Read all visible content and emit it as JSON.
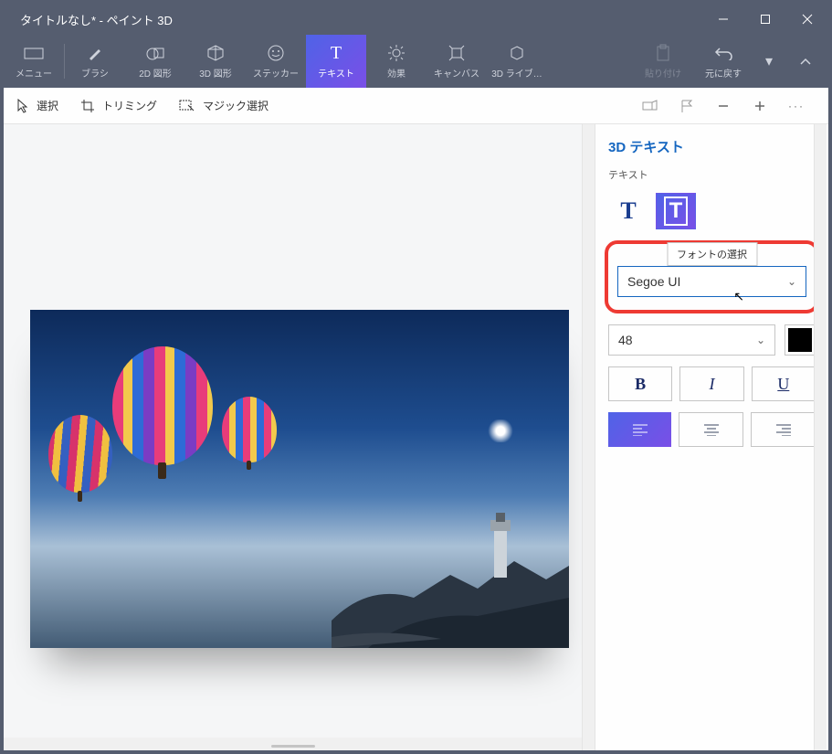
{
  "window": {
    "title": "タイトルなし* - ペイント 3D"
  },
  "ribbon": {
    "items": [
      {
        "label": "メニュー",
        "icon": "folder"
      },
      {
        "label": "ブラシ",
        "icon": "brush"
      },
      {
        "label": "2D 図形",
        "icon": "shape2d"
      },
      {
        "label": "3D 図形",
        "icon": "shape3d"
      },
      {
        "label": "ステッカー",
        "icon": "sticker"
      },
      {
        "label": "テキスト",
        "icon": "text",
        "selected": true
      },
      {
        "label": "効果",
        "icon": "effects"
      },
      {
        "label": "キャンバス",
        "icon": "canvas"
      },
      {
        "label": "3D ライブ…",
        "icon": "library"
      }
    ],
    "paste": "貼り付け",
    "undo": "元に戻す"
  },
  "subbar": {
    "select": "選択",
    "crop": "トリミング",
    "magic": "マジック選択"
  },
  "panel": {
    "title": "3D テキスト",
    "text_label": "テキスト",
    "tooltip": "フォントの選択",
    "font_value": "Segoe UI",
    "size_value": "48",
    "bold": "B",
    "italic": "I",
    "underline": "U"
  }
}
